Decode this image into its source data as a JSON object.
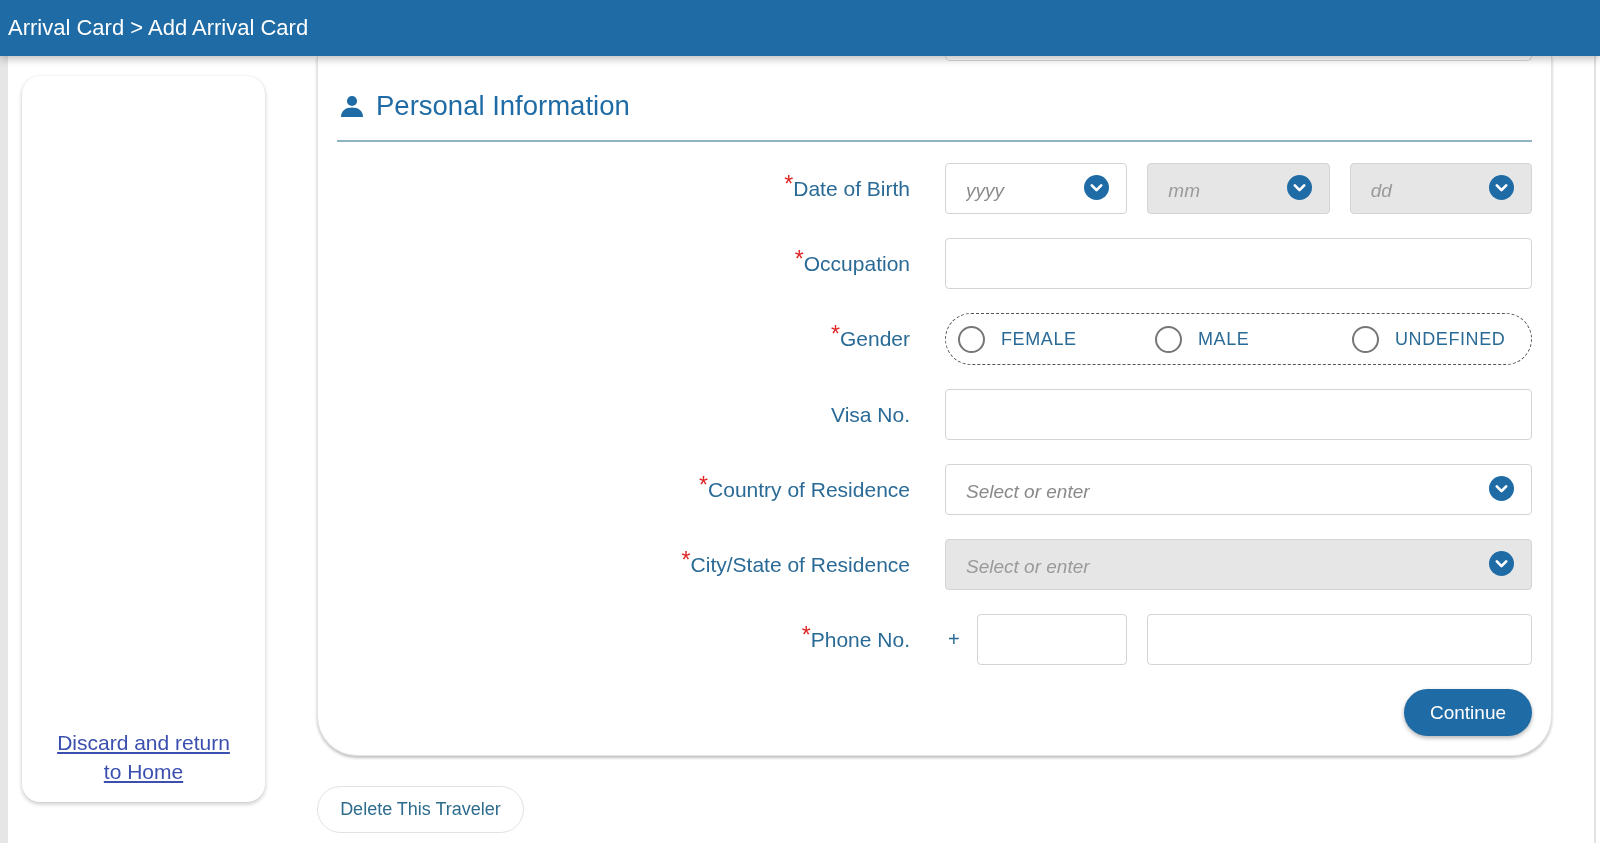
{
  "header": {
    "breadcrumb": "Arrival Card > Add Arrival Card"
  },
  "sidebar": {
    "link": "Discard and return to Home"
  },
  "section": {
    "title": "Personal Information"
  },
  "fields": [
    {
      "kind": "date",
      "label": "$^{*}$Date of Birth",
      "parts": [
        {
          "placeholder": "yyyy",
          "disabled": false
        },
        {
          "placeholder": "mm",
          "disabled": true
        },
        {
          "placeholder": "dd",
          "disabled": true
        }
      ]
    },
    {
      "kind": "text",
      "label": "$^{*}$Occupation"
    },
    {
      "kind": "radio",
      "label": "$^{*}$Gender",
      "options": [
        {
          "label": "FEMALE",
          "selected": false
        },
        {
          "label": "MALE",
          "selected": false
        },
        {
          "label": "UNDEFINED",
          "selected": false
        }
      ]
    },
    {
      "kind": "text",
      "label": "Visa No."
    },
    {
      "kind": "select",
      "label": "$^{*}$Country of Residence",
      "placeholder": "Select or enter",
      "disabled": false
    },
    {
      "kind": "select",
      "label": "$^{*}$City/State of Residence",
      "placeholder": "Select or enter",
      "disabled": true
    },
    {
      "kind": "phone",
      "label": "$^{*}$Phone No.",
      "prefix": "+"
    }
  ],
  "buttons": {
    "continue": "Continue",
    "delete": "Delete This Traveler"
  }
}
